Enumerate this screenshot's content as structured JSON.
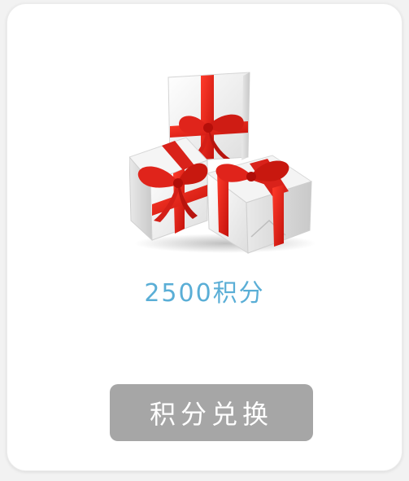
{
  "card": {
    "points_text": "2500积分",
    "redeem_label": "积分兑换"
  },
  "icons": {
    "gift": "gift-boxes-image"
  },
  "colors": {
    "points": "#5aaed6",
    "button_bg": "#a6a6a6",
    "ribbon": "#e0241b"
  }
}
